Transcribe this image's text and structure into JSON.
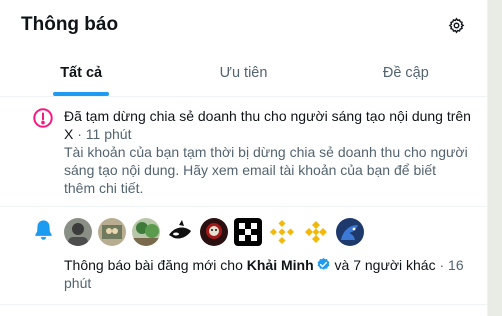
{
  "header": {
    "title": "Thông báo",
    "settings_icon": "gear-icon"
  },
  "tabs": [
    {
      "label": "Tất cả",
      "active": true
    },
    {
      "label": "Ưu tiên",
      "active": false
    },
    {
      "label": "Đề cập",
      "active": false
    }
  ],
  "notifications": [
    {
      "icon": "alert-circle-icon",
      "icon_color": "#f91880",
      "message": "Đã tạm dừng chia sẻ doanh thu cho người sáng tạo nội dung trên X",
      "separator": " · ",
      "time": "11 phút",
      "detail": "Tài khoản của bạn tạm thời bị dừng chia sẻ doanh thu cho người sáng tạo nội dung. Hãy xem email tài khoản của bạn để biết thêm chi tiết."
    },
    {
      "icon": "bell-icon",
      "icon_color": "#1d9bf0",
      "prefix": "Thông báo bài đăng mới cho",
      "user": "Khải Minh",
      "suffix": " và 7 người khác",
      "separator": " · ",
      "time": "16 phút"
    }
  ],
  "colors": {
    "accent": "#1d9bf0",
    "alert": "#f91880",
    "muted": "#536471"
  }
}
